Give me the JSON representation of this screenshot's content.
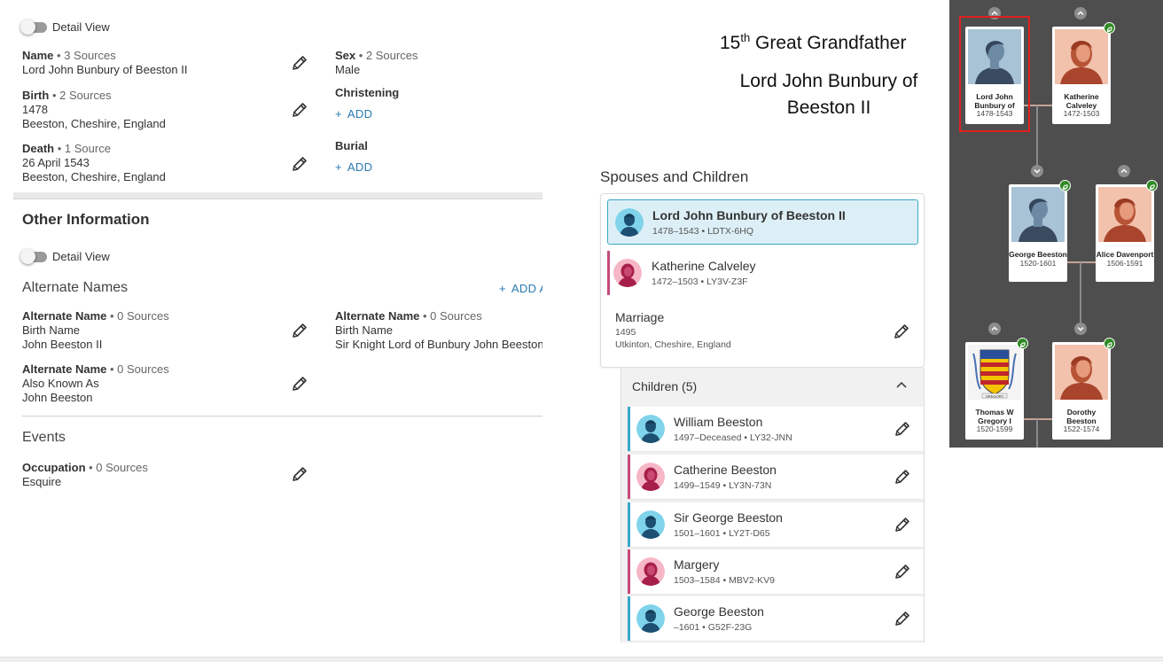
{
  "vitals": {
    "detail_view_label": "Detail View",
    "name": {
      "title": "Name",
      "sources": "3 Sources",
      "value": "Lord John Bunbury of Beeston II"
    },
    "birth": {
      "title": "Birth",
      "sources": "2 Sources",
      "date": "1478",
      "place": "Beeston, Cheshire, England"
    },
    "death": {
      "title": "Death",
      "sources": "1 Source",
      "date": "26 April 1543",
      "place": "Beeston, Cheshire, England"
    },
    "sex": {
      "title": "Sex",
      "sources": "2 Sources",
      "value": "Male"
    },
    "christening": {
      "title": "Christening",
      "add_label": "ADD"
    },
    "burial": {
      "title": "Burial",
      "add_label": "ADD"
    }
  },
  "other_info": {
    "heading": "Other Information",
    "detail_view_label": "Detail View",
    "alt_names_heading": "Alternate Names",
    "add_label": "ADD A",
    "alt_names": [
      {
        "title": "Alternate Name",
        "sources": "0 Sources",
        "type": "Birth Name",
        "value": "John Beeston II"
      },
      {
        "title": "Alternate Name",
        "sources": "0 Sources",
        "type": "Birth Name",
        "value": "Sir Knight Lord of Bunbury John Beeston"
      },
      {
        "title": "Alternate Name",
        "sources": "0 Sources",
        "type": "Also Known As",
        "value": "John Beeston"
      }
    ],
    "events_heading": "Events",
    "occupation": {
      "title": "Occupation",
      "sources": "0 Sources",
      "value": "Esquire"
    }
  },
  "overlay": {
    "relation_prefix": "15",
    "relation_sup": "th",
    "relation_suffix": " Great Grandfather",
    "name_line1": "Lord John Bunbury of",
    "name_line2": "Beeston II"
  },
  "spouses": {
    "heading": "Spouses and Children",
    "husband": {
      "name": "Lord John Bunbury of Beeston II",
      "dates": "1478–1543",
      "id": "LDTX-6HQ"
    },
    "wife": {
      "name": "Katherine Calveley",
      "dates": "1472–1503",
      "id": "LY3V-Z3F"
    },
    "marriage": {
      "label": "Marriage",
      "date": "1495",
      "place": "Utkinton, Cheshire, England"
    },
    "children_label": "Children (5)",
    "children": [
      {
        "name": "William Beeston",
        "dates": "1497–Deceased",
        "id": "LY32-JNN",
        "sex": "male"
      },
      {
        "name": "Catherine Beeston",
        "dates": "1499–1549",
        "id": "LY3N-73N",
        "sex": "female"
      },
      {
        "name": "Sir George Beeston",
        "dates": "1501–1601",
        "id": "LY2T-D65",
        "sex": "male"
      },
      {
        "name": "Margery",
        "dates": "1503–1584",
        "id": "MBV2-KV9",
        "sex": "female"
      },
      {
        "name": "George Beeston",
        "dates": "–1601",
        "id": "G52F-23G",
        "sex": "male"
      }
    ]
  },
  "tree": {
    "gen1_father": {
      "name": "Lord John Bunbury of",
      "dates": "1478-1543"
    },
    "gen1_mother": {
      "name": "Katherine Calveley",
      "dates": "1472-1503"
    },
    "gen2_father": {
      "name": "George Beeston",
      "dates": "1520-1601"
    },
    "gen2_mother": {
      "name": "Alice Davenport",
      "dates": "1506-1591"
    },
    "gen3_father": {
      "name": "Thomas W Gregory I",
      "dates": "1520-1599"
    },
    "gen3_mother": {
      "name": "Dorothy Beeston",
      "dates": "1522-1574"
    },
    "coat_of_arms_text": "GREGORY"
  },
  "colors": {
    "male_bar": "#3aa7c9",
    "female_bar": "#c64a7c",
    "link_blue": "#2a7ab0",
    "selected_highlight": "#ddeff6",
    "tree_bg": "#4e4e4e",
    "badge_green": "#2f8a23",
    "focus_outline": "#e02020"
  }
}
